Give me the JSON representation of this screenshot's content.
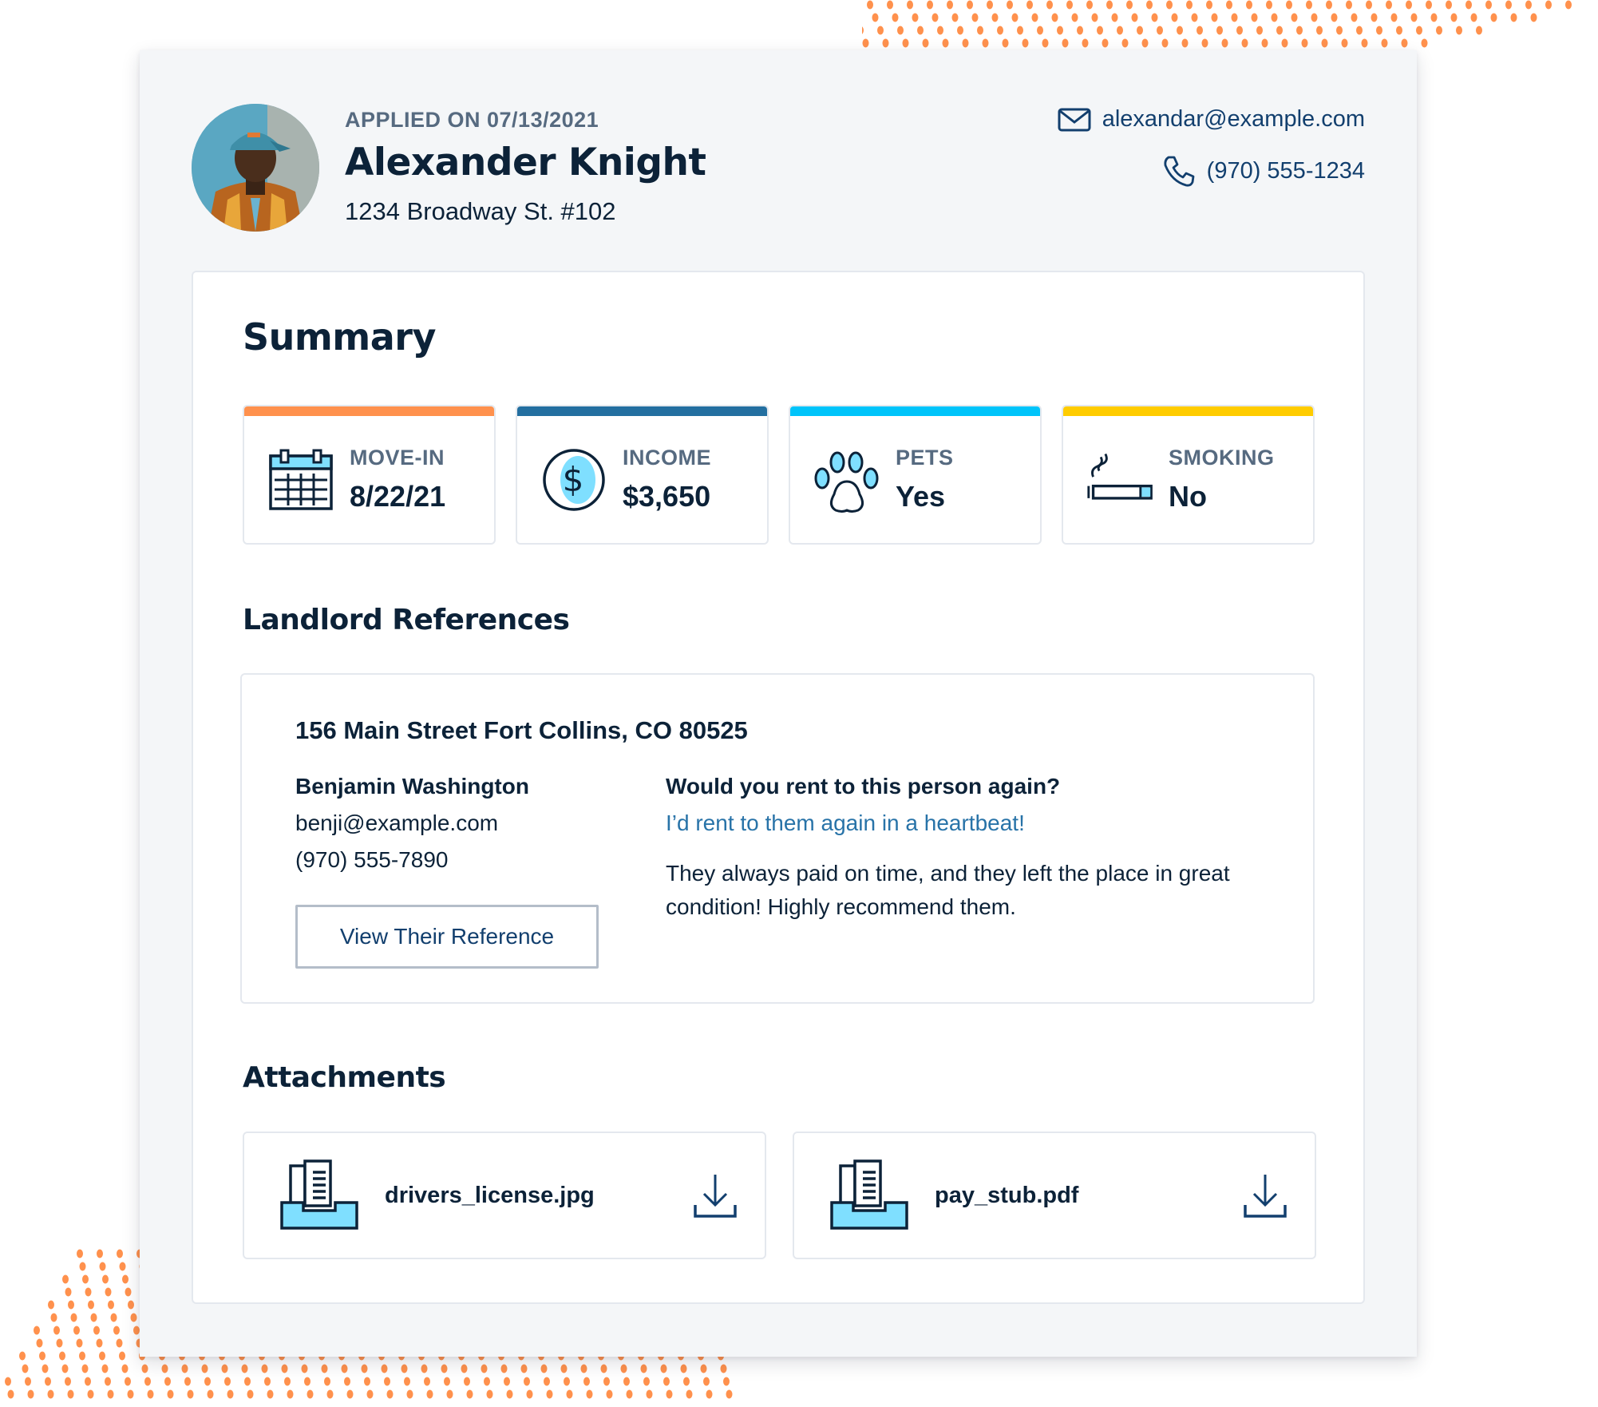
{
  "applicant": {
    "applied_on": "APPLIED ON 07/13/2021",
    "name": "Alexander Knight",
    "address": "1234 Broadway St. #102",
    "email": "alexandar@example.com",
    "phone": "(970) 555-1234",
    "avatar_alt": "Applicant photo"
  },
  "summary": {
    "title": "Summary",
    "stats": [
      {
        "label": "MOVE-IN",
        "value": "8/22/21",
        "icon": "calendar-icon",
        "accent": "#ff914d"
      },
      {
        "label": "INCOME",
        "value": "$3,650",
        "icon": "dollar-coin-icon",
        "accent": "#236fa0"
      },
      {
        "label": "PETS",
        "value": "Yes",
        "icon": "paw-icon",
        "accent": "#00c4fa"
      },
      {
        "label": "SMOKING",
        "value": "No",
        "icon": "cigarette-icon",
        "accent": "#ffcc00"
      }
    ]
  },
  "landlord_references": {
    "title": "Landlord References",
    "items": [
      {
        "property_address": "156 Main Street Fort Collins, CO 80525",
        "landlord_name": "Benjamin Washington",
        "landlord_email": "benji@example.com",
        "landlord_phone": "(970) 555-7890",
        "button_label": "View Their Reference",
        "question": "Would you rent to this person again?",
        "answer": "I’d rent to them again in a heartbeat!",
        "comment": "They always paid on time, and they left the place in great condition! Highly recommend them."
      }
    ]
  },
  "attachments": {
    "title": "Attachments",
    "files": [
      {
        "name": "drivers_license.jpg",
        "icon": "document-tray-icon",
        "action_icon": "download-icon"
      },
      {
        "name": "pay_stub.pdf",
        "icon": "document-tray-icon",
        "action_icon": "download-icon"
      }
    ]
  },
  "colors": {
    "primary_text": "#0c2238",
    "muted_text": "#566a80",
    "link": "#2873a8",
    "contact": "#123f6e",
    "icon_fill": "#7fdfff",
    "decor_dots": "#ff914d"
  }
}
